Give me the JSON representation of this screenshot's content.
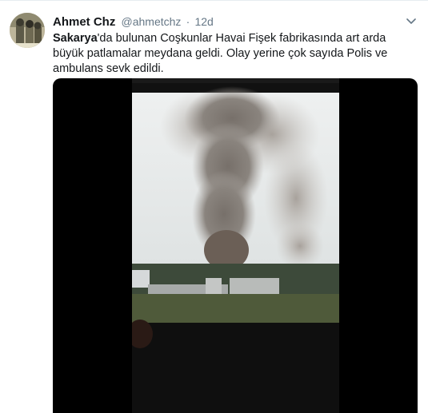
{
  "tweet": {
    "name": "Ahmet Chz",
    "handle": "@ahmetchz",
    "separator": "·",
    "time": "12d",
    "text_bold": "Sakarya",
    "text_rest": "'da bulunan Coşkunlar Havai Fişek fabrikasında art arda büyük patlamalar meydana geldi. Olay yerine çok sayıda Polis ve ambulans sevk edildi."
  },
  "icons": {
    "caret": "chevron-down-icon",
    "avatar": "avatar"
  },
  "colors": {
    "text": "#14171a",
    "secondary": "#657786",
    "border": "#e6ecf0",
    "media_bg": "#000000"
  }
}
